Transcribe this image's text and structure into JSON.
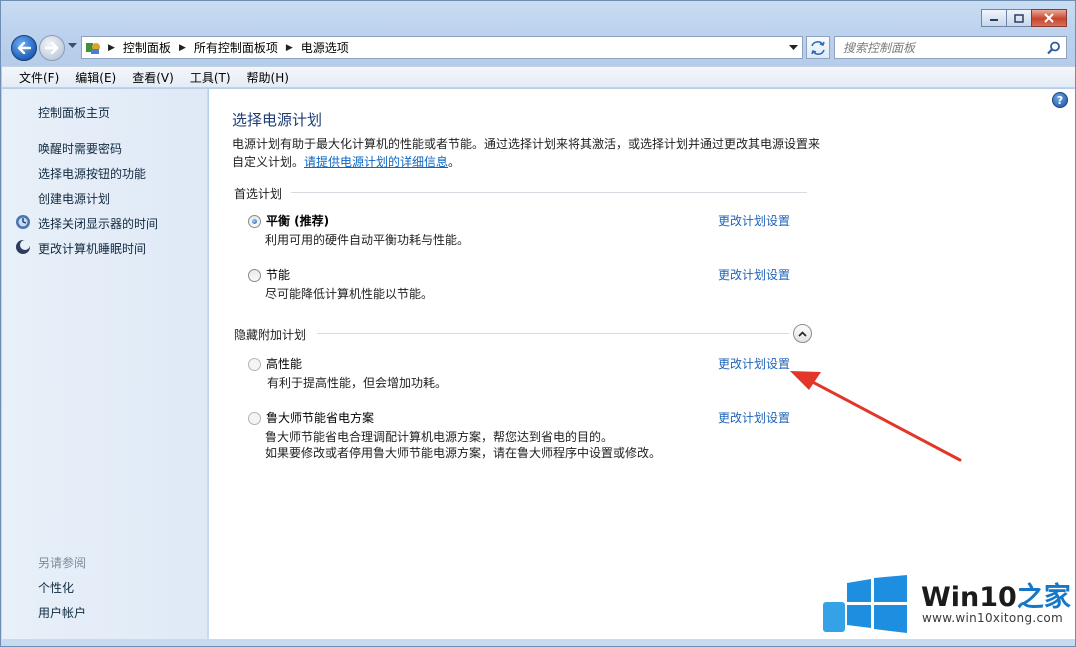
{
  "window": {
    "caption": {
      "minimize": "minimize",
      "maximize": "maximize",
      "close": "close"
    }
  },
  "address": {
    "breadcrumbs": [
      "控制面板",
      "所有控制面板项",
      "电源选项"
    ],
    "search_placeholder": "搜索控制面板"
  },
  "menubar": {
    "items": [
      "文件(F)",
      "编辑(E)",
      "查看(V)",
      "工具(T)",
      "帮助(H)"
    ]
  },
  "sidebar": {
    "home": "控制面板主页",
    "items": [
      {
        "label": "唤醒时需要密码",
        "icon": ""
      },
      {
        "label": "选择电源按钮的功能",
        "icon": ""
      },
      {
        "label": "创建电源计划",
        "icon": ""
      },
      {
        "label": "选择关闭显示器的时间",
        "icon": "monitor-icon"
      },
      {
        "label": "更改计算机睡眠时间",
        "icon": "moon-icon"
      }
    ],
    "see_also_heading": "另请参阅",
    "see_also": [
      "个性化",
      "用户帐户"
    ]
  },
  "main": {
    "title": "选择电源计划",
    "description_text": "电源计划有助于最大化计算机的性能或者节能。通过选择计划来将其激活，或选择计划并通过更改其电源设置来自定义计划。",
    "description_link": "请提供电源计划的详细信息",
    "description_end": "。",
    "preferred_heading": "首选计划",
    "hidden_heading": "隐藏附加计划",
    "plans": [
      {
        "name": "平衡 (推荐)",
        "desc": [
          "利用可用的硬件自动平衡功耗与性能。"
        ],
        "link": "更改计划设置",
        "selected": true
      },
      {
        "name": "节能",
        "desc": [
          "尽可能降低计算机性能以节能。"
        ],
        "link": "更改计划设置",
        "selected": false
      },
      {
        "name": "高性能",
        "desc": [
          "有利于提高性能，但会增加功耗。"
        ],
        "link": "更改计划设置",
        "selected": false
      },
      {
        "name": "鲁大师节能省电方案",
        "desc": [
          "鲁大师节能省电合理调配计算机电源方案，帮您达到省电的目的。",
          "如果要修改或者停用鲁大师节能电源方案，请在鲁大师程序中设置或修改。"
        ],
        "link": "更改计划设置",
        "selected": false
      }
    ]
  },
  "watermark": {
    "brand": "Win10",
    "brand_zh": "之家",
    "url": "www.win10xitong.com"
  },
  "colors": {
    "link": "#1f64b8",
    "title": "#1d3d74",
    "arrow": "#e2362a",
    "logo_blue": "#1677c9"
  }
}
